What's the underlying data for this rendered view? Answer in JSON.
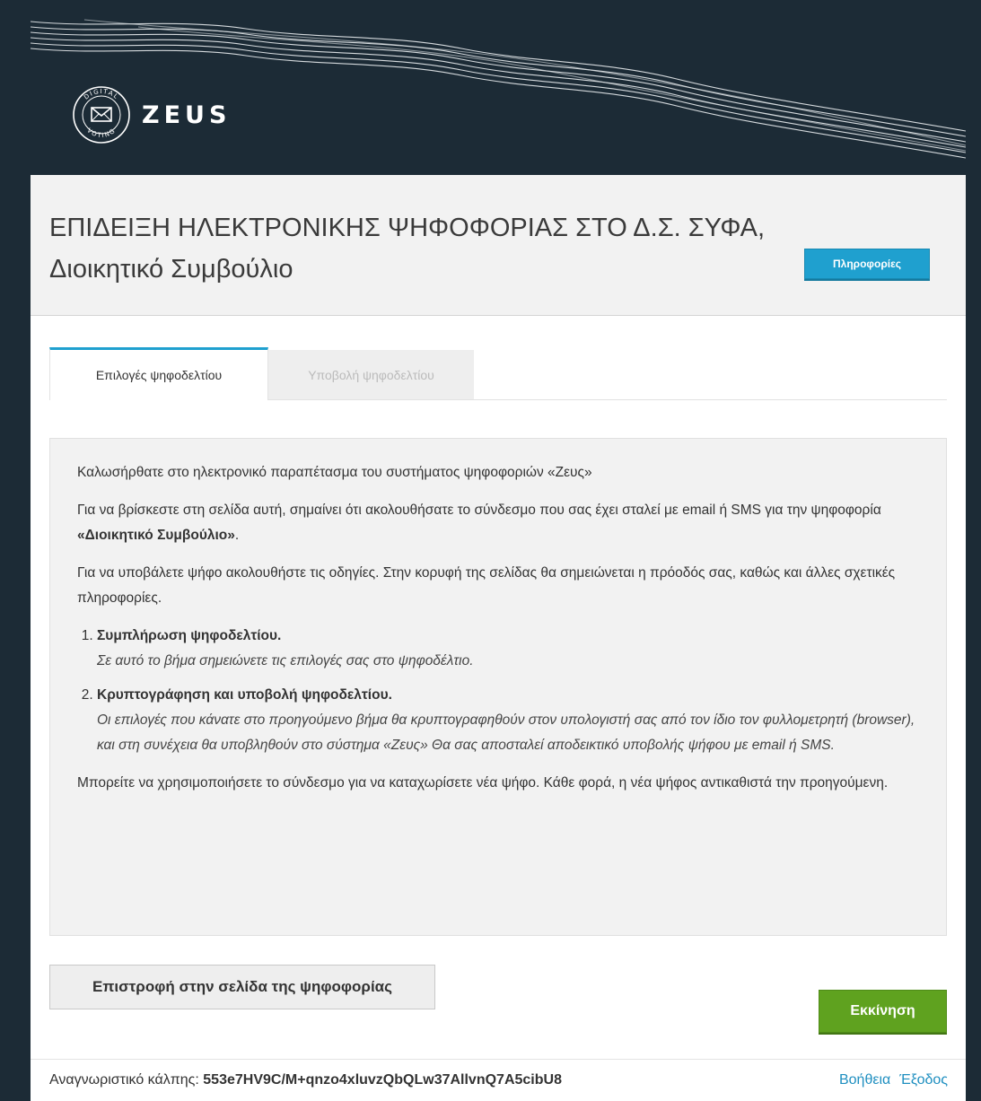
{
  "header": {
    "logo_text": "ZEUS",
    "logo_ring_text_top": "DIGITAL",
    "logo_ring_text_bottom": "VOTING",
    "background": "#1c2b36"
  },
  "election": {
    "title": "ΕΠΙΔΕΙΞΗ ΗΛΕΚΤΡΟΝΙΚΗΣ ΨΗΦΟΦΟΡΙΑΣ ΣΤΟ Δ.Σ. ΣΥΦΑ, Διοικητικό Συμβούλιο",
    "info_button": "Πληροφορίες"
  },
  "tabs": [
    {
      "label": "Επιλογές ψηφοδελτίου",
      "state": "active"
    },
    {
      "label": "Υποβολή ψηφοδελτίου",
      "state": "disabled"
    }
  ],
  "content": {
    "welcome": "Καλωσήρθατε στο ηλεκτρονικό παραπέτασμα του συστήματος ψηφοφοριών «Ζευς»",
    "link_text_before": "Για να βρίσκεστε στη σελίδα αυτή, σημαίνει ότι ακολουθήσατε το σύνδεσμο που σας έχει σταλεί με email ή SMS για την ψηφοφορία ",
    "link_text_bold": "«Διοικητικό Συμβούλιο»",
    "link_text_after": ".",
    "instructions": "Για να υποβάλετε ψήφο ακολουθήστε τις οδηγίες. Στην κορυφή της σελίδας θα σημειώνεται η πρόοδός σας, καθώς και άλλες σχετικές πληροφορίες.",
    "steps": [
      {
        "title": "Συμπλήρωση ψηφοδελτίου.",
        "description": "Σε αυτό το βήμα σημειώνετε τις επιλογές σας στο ψηφοδέλτιο."
      },
      {
        "title": "Κρυπτογράφηση και υποβολή ψηφοδελτίου.",
        "description": "Οι επιλογές που κάνατε στο προηγούμενο βήμα θα κρυπτογραφηθούν στον υπολογιστή σας από τον ίδιο τον φυλλομετρητή (browser), και στη συνέχεια θα υποβληθούν στο σύστημα «Ζευς» Θα σας αποσταλεί αποδεικτικό υποβολής ψήφου με email ή SMS."
      }
    ],
    "revote_note": "Μπορείτε να χρησιμοποιήσετε το σύνδεσμο για να καταχωρίσετε νέα ψήφο. Κάθε φορά, η νέα ψήφος αντικαθιστά την προηγούμενη."
  },
  "actions": {
    "back_button": "Επιστροφή στην σελίδα της ψηφοφορίας",
    "start_button": "Εκκίνηση"
  },
  "footer": {
    "voter_id_label": "Αναγνωριστικό κάλπης:",
    "voter_id_value": "553e7HV9C/M+qnzo4xluvzQbQLw37AllvnQ7A5cibU8",
    "help_link": "Βοήθεια",
    "logout_link": "Έξοδος"
  },
  "colors": {
    "accent_blue": "#1fa0cf",
    "start_green": "#5fa21f",
    "link_blue": "#1f8fc0"
  }
}
